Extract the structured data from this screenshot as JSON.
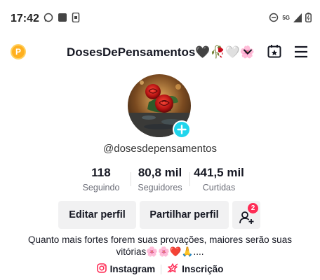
{
  "status_bar": {
    "time": "17:42",
    "network": "5G"
  },
  "header": {
    "coin_label": "P",
    "username": "DosesDePensamentos🖤🥀🤍🌸"
  },
  "profile": {
    "handle": "@dosesdepensamentos",
    "stats": [
      {
        "value": "118",
        "label": "Seguindo"
      },
      {
        "value": "80,8 mil",
        "label": "Seguidores"
      },
      {
        "value": "441,5 mil",
        "label": "Curtidas"
      }
    ],
    "buttons": {
      "edit": "Editar perfil",
      "share": "Partilhar perfil",
      "add_friends_badge": "2"
    },
    "bio_line1": "Quanto mais fortes forem suas provações, maiores serão suas",
    "bio_line2": "vitórias🌸🌸❤️🙏....",
    "links": [
      {
        "label": "Instagram",
        "icon": "instagram-icon"
      },
      {
        "label": "Inscrição",
        "icon": "subscription-icon"
      }
    ]
  },
  "colors": {
    "accent_red": "#fe2c55",
    "plus_cyan": "#20d5ec",
    "coin_orange": "#ffb020"
  }
}
